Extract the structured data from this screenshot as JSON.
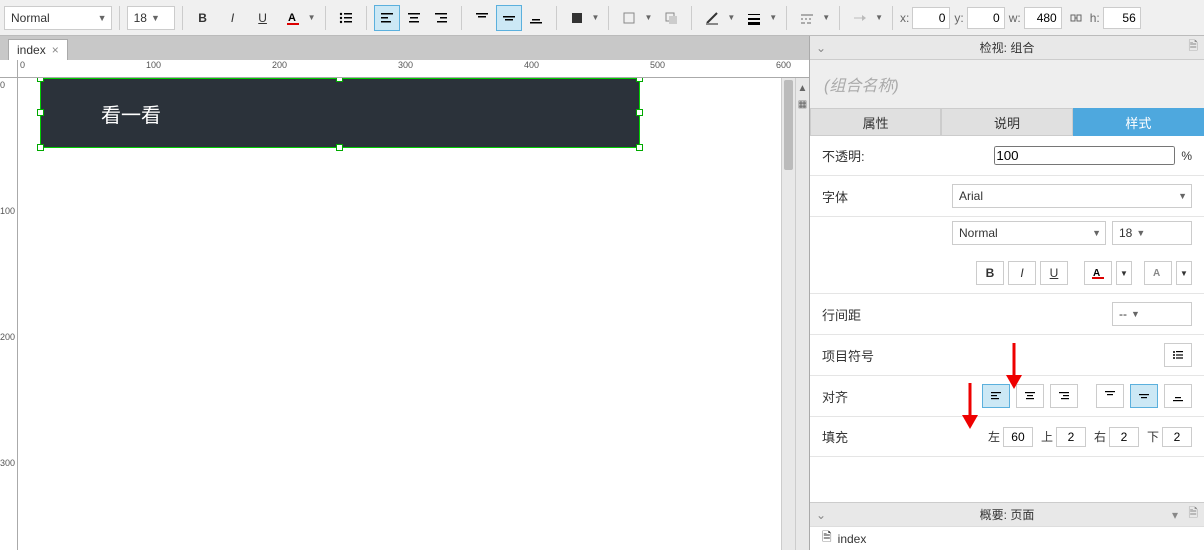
{
  "toolbar": {
    "style_select": "Normal",
    "font_size": "18",
    "pos": {
      "x_label": "x:",
      "x": "0",
      "y_label": "y:",
      "y": "0",
      "w_label": "w:",
      "w": "480",
      "h_label": "h:",
      "h": "56"
    }
  },
  "tab": {
    "name": "index"
  },
  "ruler_h": [
    "0",
    "100",
    "200",
    "300",
    "400",
    "500",
    "600"
  ],
  "ruler_v": [
    "0",
    "100",
    "200",
    "300"
  ],
  "widget": {
    "text": "看一看"
  },
  "inspector": {
    "header": "检视: 组合",
    "group_placeholder": "(组合名称)",
    "tabs": {
      "attrs": "属性",
      "desc": "说明",
      "style": "样式"
    },
    "opacity": {
      "label": "不透明:",
      "value": "100",
      "unit": "%"
    },
    "font": {
      "label": "字体",
      "family": "Arial",
      "weight": "Normal",
      "size": "18"
    },
    "line_spacing": {
      "label": "行间距",
      "value": "--"
    },
    "bullets": {
      "label": "项目符号"
    },
    "align": {
      "label": "对齐"
    },
    "padding": {
      "label": "填充",
      "left_l": "左",
      "left": "60",
      "top_l": "上",
      "top": "2",
      "right_l": "右",
      "right": "2",
      "bottom_l": "下",
      "bottom": "2"
    }
  },
  "footer": {
    "title": "概要: 页面",
    "item": "index"
  }
}
